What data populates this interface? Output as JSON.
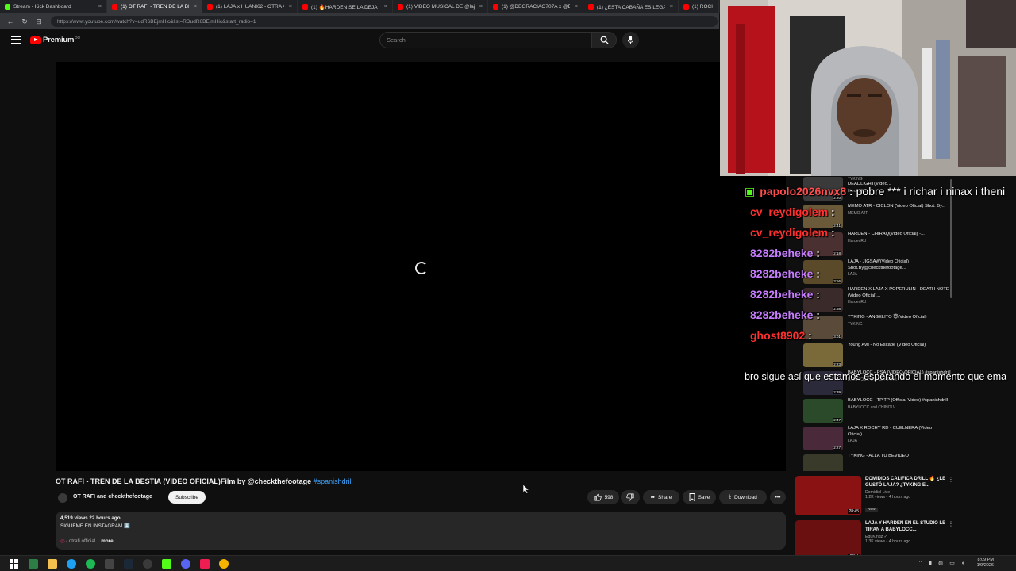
{
  "browser": {
    "tabs": [
      {
        "label": "Stream - Kick Dashboard",
        "color": "#53fc18"
      },
      {
        "label": "(1) OT RAFI - TREN DE LA BESTIA",
        "color": "#ff0000"
      },
      {
        "label": "(1) LAJA x HUANI62 - OTRA AMIG",
        "color": "#ff0000"
      },
      {
        "label": "(1) 🔥HARDEN SE LA DEJA CAER",
        "color": "#ff0000"
      },
      {
        "label": "(1) VIDEO MUSICAL DE @lajaOfic",
        "color": "#ff0000"
      },
      {
        "label": "(1) @DEGRACIAO707A x @BLIZZ",
        "color": "#ff0000"
      },
      {
        "label": "(1) ¿ESTA CABAÑA ES LEGAL? 😳",
        "color": "#ff0000"
      },
      {
        "label": "(1) ROCHY",
        "color": "#ff0000"
      }
    ],
    "url": "https://www.youtube.com/watch?v=udR6BEjmHic&list=RDudR6BEjmHic&start_radio=1"
  },
  "youtube": {
    "logo_text": "Premium",
    "logo_sup": "DO",
    "search_placeholder": "Search"
  },
  "video": {
    "title": "OT RAFI - TREN DE LA BESTIA (VIDEO OFICIAL)Film by @checkthefootage",
    "hashtag": "#spanishdrill",
    "channel": "OT RAFI and checkthefootage",
    "subscribe": "Subscribe",
    "likes": "598",
    "share": "Share",
    "save": "Save",
    "download": "Download",
    "views_line": "4,519 views  22 hours ago",
    "desc_line": "SIGUEME EN INSTAGRAM ⬇️",
    "ig_handle": "/ otrafi.official",
    "more": "...more"
  },
  "chat": [
    {
      "user": "papolo2026nvx8",
      "color": "#ff4d4d",
      "msg": "pobre *** i richar i ninax i theni",
      "badge": true
    },
    {
      "user": "cv_reydigolem",
      "color": "#ff3030",
      "msg": ""
    },
    {
      "user": "cv_reydigolem",
      "color": "#ff3030",
      "msg": ""
    },
    {
      "user": "8282beheke",
      "color": "#c77dff",
      "msg": ""
    },
    {
      "user": "8282beheke",
      "color": "#c77dff",
      "msg": ""
    },
    {
      "user": "8282beheke",
      "color": "#c77dff",
      "msg": ""
    },
    {
      "user": "8282beheke",
      "color": "#c77dff",
      "msg": ""
    },
    {
      "user": "ghost8902",
      "color": "#ff3030",
      "msg": ""
    }
  ],
  "chat_wrap": "bro sigue así que estamos esperando el momento que ema",
  "recommended": [
    {
      "title": "DEADLIGHT(Video...",
      "channel": "HardenRd",
      "duration": "2:20",
      "top": "TYKING"
    },
    {
      "title": "MEMO ATR - CICLON (Video Oficial) Shot. By...",
      "channel": "MEMO ATR",
      "duration": "2:41"
    },
    {
      "title": "HARDEN - CHIRAQ(Video Oficial) -...",
      "channel": "HardenRd",
      "duration": "2:18"
    },
    {
      "title": "LAJA - JIGSAW(Video Oficial) Shot.By@checkthefootage...",
      "channel": "LAJA",
      "duration": "3:56"
    },
    {
      "title": "HARDEN X LAJA X POPERULIN - DEATH NOTE (Video Oficial)...",
      "channel": "HardenRd",
      "duration": "2:58"
    },
    {
      "title": "TYKING - ANGELITO 😇(Video Oficial)",
      "channel": "TYKING",
      "duration": "3:01"
    },
    {
      "title": "Young Avli - No Escape (Video Oficial)",
      "channel": "",
      "duration": "2:23"
    },
    {
      "title": "BABYLOCC - PSA (VIDEO OFICIAL) #spanishdrill",
      "channel": "BABYLOCC and CDF Films",
      "duration": "2:39"
    },
    {
      "title": "BABYLOCC - TP TP (Official Video) #spanishdrill",
      "channel": "BABYLOCC and CHINOLV",
      "duration": "2:47"
    },
    {
      "title": "LAJA X ROCHY RD - CUELNERA (Video Oficial)...",
      "channel": "LAJA",
      "duration": "2:27"
    },
    {
      "title": "TYKING - ALLA TU BEVIDEO",
      "channel": "",
      "duration": ""
    }
  ],
  "bottom_recs": [
    {
      "title": "DOMIDIOS CALIFICA DRILL 🔥 ¿LE GUSTÓ LAJA? ¿TYKING E...",
      "channel": "Domidiol Live",
      "stats": "1.2K views • 4 hours ago",
      "badge": "New",
      "duration": "28:45"
    },
    {
      "title": "LAJA Y HARDEN EN EL STUDIO LE TIRAN A BABYLOCC...",
      "channel": "EduKingz ✓",
      "stats": "1.3K views • 4 hours ago",
      "badge": "",
      "duration": "20:01"
    }
  ],
  "taskbar": {
    "time": "8:09 PM",
    "date": "1/9/2026"
  }
}
